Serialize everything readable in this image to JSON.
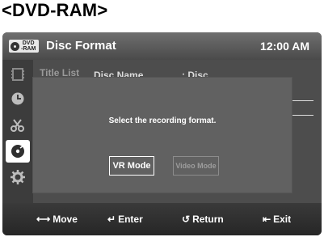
{
  "heading": "<DVD-RAM>",
  "titlebar": {
    "badge_line1": "DVD",
    "badge_line2": "-RAM",
    "title": "Disc Format",
    "clock": "12:00 AM"
  },
  "sidebar": {
    "items": [
      {
        "icon": "film-icon"
      },
      {
        "icon": "clock-icon"
      },
      {
        "icon": "scissors-icon"
      },
      {
        "icon": "disc-icon"
      },
      {
        "icon": "gear-icon"
      }
    ]
  },
  "menu": {
    "title_list": "Title List",
    "disc_name_label": "Disc Name",
    "disc_name_value": ": Disc"
  },
  "dialog": {
    "message": "Select the recording format.",
    "vr_mode": "VR Mode",
    "video_mode": "Video Mode"
  },
  "footer": {
    "move": "Move",
    "enter": "Enter",
    "return": "Return",
    "exit": "Exit"
  }
}
